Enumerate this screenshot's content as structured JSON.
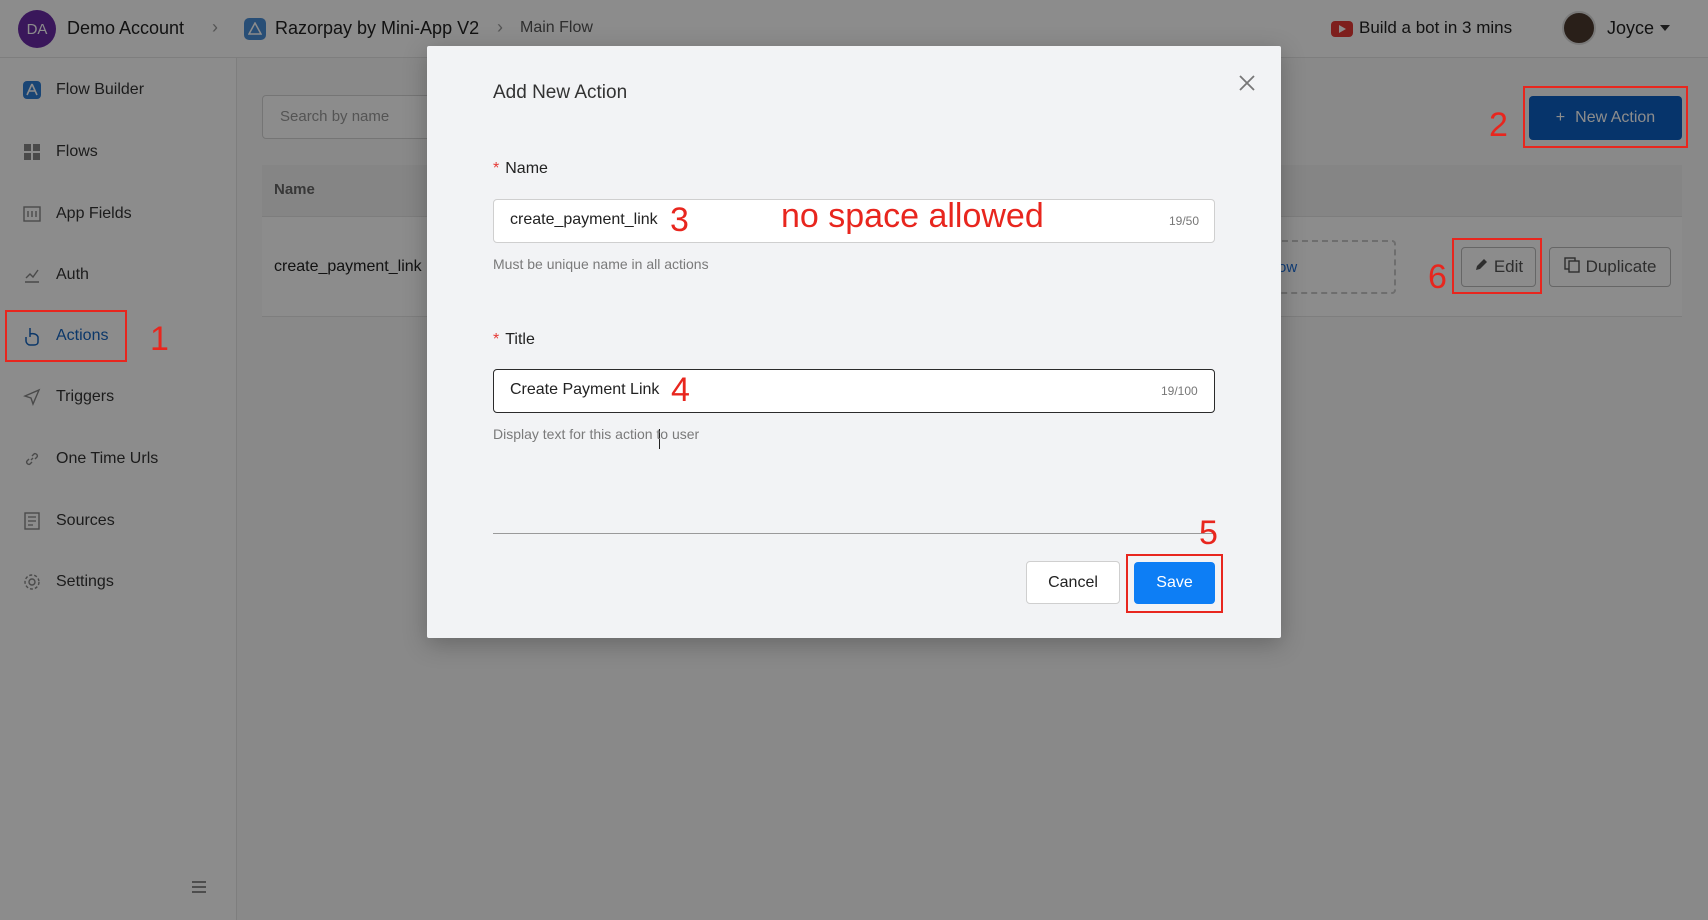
{
  "header": {
    "account_initials": "DA",
    "account_name": "Demo Account",
    "app_name": "Razorpay by Mini-App V2",
    "breadcrumb_current": "Main Flow",
    "build_link": "Build a bot in 3 mins",
    "user_name": "Joyce"
  },
  "sidebar": {
    "items": [
      {
        "label": "Flow Builder",
        "icon": "flow-builder-icon"
      },
      {
        "label": "Flows",
        "icon": "grid-icon"
      },
      {
        "label": "App Fields",
        "icon": "fields-icon"
      },
      {
        "label": "Auth",
        "icon": "auth-icon"
      },
      {
        "label": "Actions",
        "icon": "pointer-icon",
        "active": true
      },
      {
        "label": "Triggers",
        "icon": "send-icon"
      },
      {
        "label": "One Time Urls",
        "icon": "link-icon"
      },
      {
        "label": "Sources",
        "icon": "document-icon"
      },
      {
        "label": "Settings",
        "icon": "gear-icon"
      }
    ]
  },
  "main": {
    "search_placeholder": "Search by name",
    "new_action_label": "New Action",
    "table": {
      "headers": [
        "Name"
      ],
      "rows": [
        {
          "name": "create_payment_link",
          "flow_link": "ow",
          "edit_label": "Edit",
          "duplicate_label": "Duplicate"
        }
      ]
    }
  },
  "modal": {
    "title": "Add New Action",
    "name_field": {
      "label": "Name",
      "required_mark": "*",
      "value": "create_payment_link",
      "counter": "19/50",
      "hint": "Must be unique name in all actions"
    },
    "title_field": {
      "label": "Title",
      "required_mark": "*",
      "value": "Create Payment Link",
      "counter": "19/100",
      "hint": "Display text for this action to user"
    },
    "cancel_label": "Cancel",
    "save_label": "Save"
  },
  "annotations": {
    "step_1": "1",
    "step_2": "2",
    "step_3": "3",
    "step_4": "4",
    "step_5": "5",
    "step_6": "6",
    "note": "no space allowed",
    "color": "#e8261e"
  },
  "colors": {
    "primary_button": "#0b5fc4",
    "save_button": "#0d7ef5",
    "active_nav": "#1565c0",
    "account_avatar": "#6a2aa6"
  }
}
